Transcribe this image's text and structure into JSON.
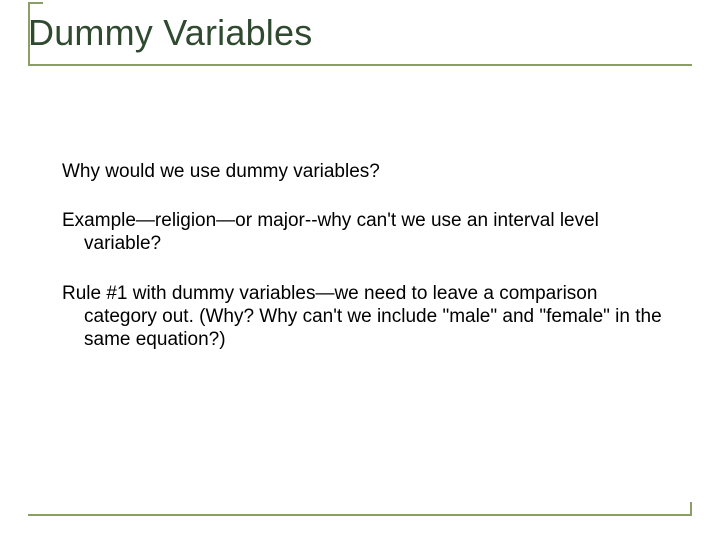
{
  "slide": {
    "title": "Dummy Variables",
    "paragraphs": [
      "Why would we use dummy variables?",
      "Example—religion—or major--why can't we use an interval level variable?",
      "Rule #1 with dummy variables—we need to leave a comparison category out.  (Why?  Why can't we include \"male\" and \"female\" in the same equation?)"
    ]
  },
  "colors": {
    "title_text": "#2f4a2f",
    "accent_line": "#8a9e66",
    "body_text": "#000000",
    "background": "#ffffff"
  }
}
